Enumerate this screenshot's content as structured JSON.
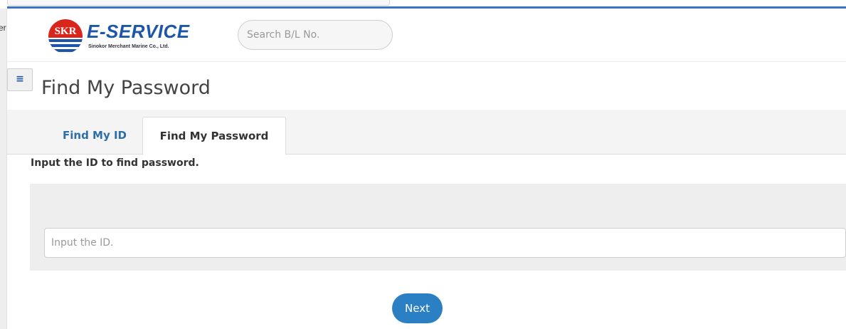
{
  "chrome": {
    "gutter_text": "er"
  },
  "header": {
    "logo_badge": "SKR",
    "logo_title": "E-SERVICE",
    "logo_subtitle": "Sinokor Merchant Marine Co., Ltd.",
    "search_placeholder": "Search B/L No.",
    "search_value": ""
  },
  "page": {
    "menu_toggle_icon": "hamburger-icon",
    "menu_toggle_glyph": "≡",
    "title": "Find My Password"
  },
  "tabs": [
    {
      "label": "Find My ID",
      "active": false
    },
    {
      "label": "Find My Password",
      "active": true
    }
  ],
  "form": {
    "instruction": "Input the ID to find password.",
    "id_placeholder": "Input the ID.",
    "id_value": "",
    "next_label": "Next"
  },
  "colors": {
    "brand_blue": "#1d56a8",
    "accent_line": "#3b74c5",
    "tab_link": "#2d6ea8",
    "button_bg": "#2b7fc3",
    "logo_red": "#d9261c"
  }
}
